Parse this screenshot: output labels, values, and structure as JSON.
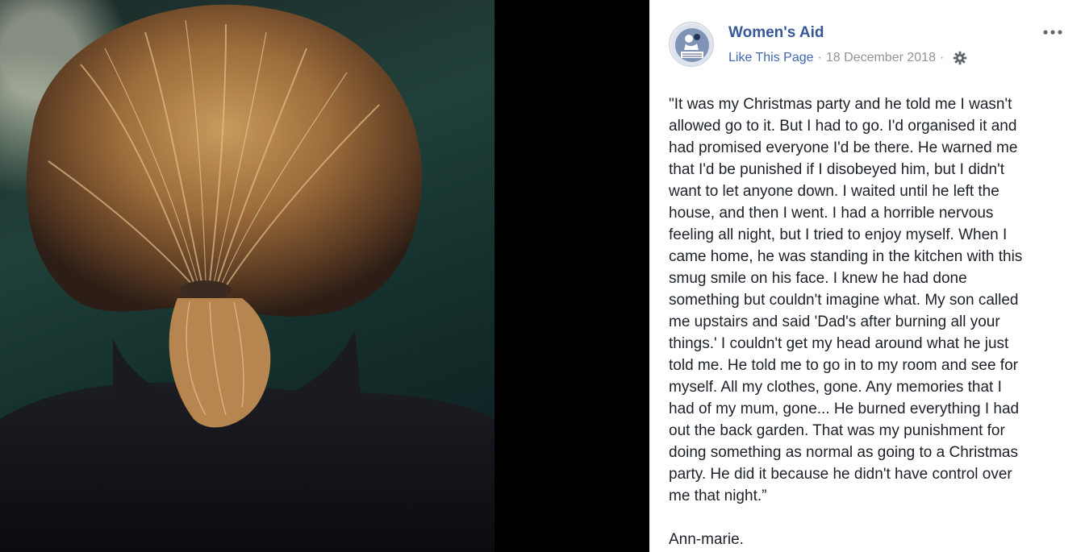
{
  "post": {
    "page_name": "Women's Aid",
    "like_link": "Like This Page",
    "separator": "·",
    "date": "18 December 2018",
    "body_lines": [
      "\"It was my Christmas party and he told me I wasn't",
      "allowed go to it. But I had to go. I'd organised it and",
      "had promised everyone I'd be there. He warned me",
      "that I'd be punished if I disobeyed him, but I didn't",
      "want to let anyone down. I waited until he left the",
      "house, and then I went. I had a horrible nervous",
      "feeling all night, but I tried to enjoy myself. When I",
      "came home, he was standing in the kitchen with this",
      "smug smile on his face. I knew he had done",
      "something but couldn't imagine what. My son called",
      "me upstairs and said 'Dad's after burning all your",
      "things.' I couldn't get my head around what he just",
      "told me. He told me to go in to my room and see for",
      "myself. All my clothes, gone. Any memories that I",
      "had of my mum, gone... He burned everything I had",
      "out the back garden. That was my punishment for",
      "doing something as normal as going to a Christmas",
      "party. He did it because he didn't have control over",
      "me that night.”"
    ],
    "signature": "Ann-marie."
  },
  "icons": {
    "avatar": "womens-aid-logo",
    "audience": "gear-icon",
    "menu": "more-options-icon"
  },
  "colors": {
    "link": "#365899",
    "like": "#4267b2",
    "meta": "#90949c",
    "text": "#1d2129"
  }
}
